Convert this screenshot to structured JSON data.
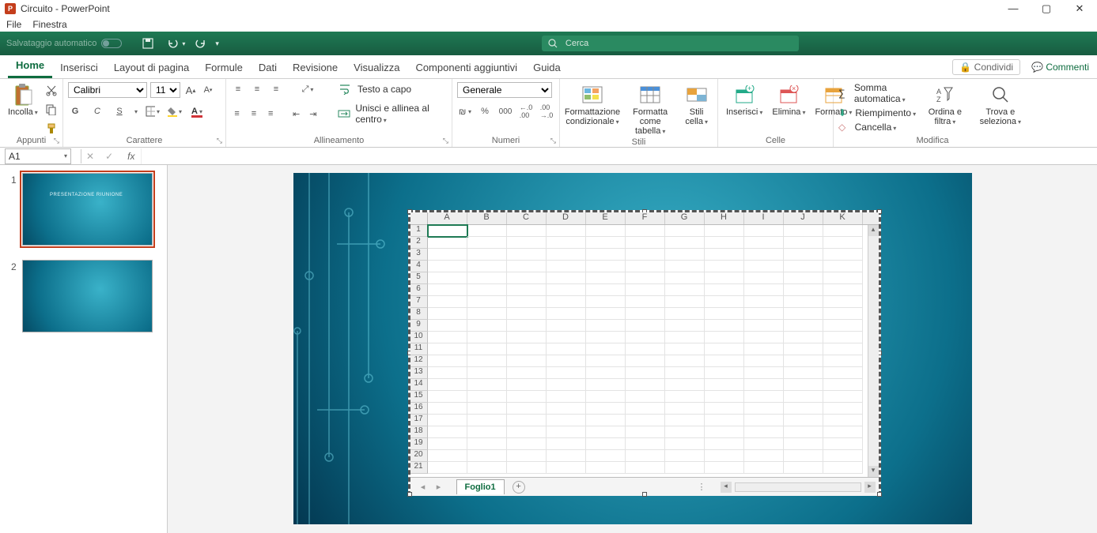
{
  "titlebar": {
    "app_initial": "P",
    "title": "Circuito - PowerPoint"
  },
  "menu": {
    "file": "File",
    "window": "Finestra"
  },
  "qat": {
    "autosave": "Salvataggio automatico",
    "search_placeholder": "Cerca"
  },
  "tabs": {
    "home": "Home",
    "insert": "Inserisci",
    "layout": "Layout di pagina",
    "formulas": "Formule",
    "data": "Dati",
    "review": "Revisione",
    "view": "Visualizza",
    "addins": "Componenti aggiuntivi",
    "help": "Guida",
    "share": "Condividi",
    "comments": "Commenti"
  },
  "ribbon": {
    "clipboard": {
      "paste": "Incolla",
      "group": "Appunti"
    },
    "font": {
      "name": "Calibri",
      "size": "11",
      "group": "Carattere",
      "bold": "G",
      "italic": "C",
      "underline": "S"
    },
    "align": {
      "wrap": "Testo a capo",
      "merge": "Unisci e allinea al centro",
      "group": "Allineamento"
    },
    "number": {
      "format": "Generale",
      "group": "Numeri",
      "thousand": "000"
    },
    "styles": {
      "cond": "Formattazione condizionale",
      "table": "Formatta come tabella",
      "cell": "Stili cella",
      "group": "Stili"
    },
    "cells": {
      "insert": "Inserisci",
      "delete": "Elimina",
      "format": "Formato",
      "group": "Celle"
    },
    "editing": {
      "sum": "Somma automatica",
      "fill": "Riempimento",
      "clear": "Cancella",
      "sort": "Ordina e filtra",
      "find": "Trova e seleziona",
      "group": "Modifica"
    }
  },
  "fbar": {
    "name": "A1",
    "fx": "fx"
  },
  "slides": {
    "s1": "1",
    "s2": "2",
    "title1": "PRESENTAZIONE RIUNIONE"
  },
  "sheet": {
    "cols": [
      "A",
      "B",
      "C",
      "D",
      "E",
      "F",
      "G",
      "H",
      "I",
      "J",
      "K"
    ],
    "rows": [
      "1",
      "2",
      "3",
      "4",
      "5",
      "6",
      "7",
      "8",
      "9",
      "10",
      "11",
      "12",
      "13",
      "14",
      "15",
      "16",
      "17",
      "18",
      "19",
      "20",
      "21"
    ],
    "tab": "Foglio1"
  }
}
